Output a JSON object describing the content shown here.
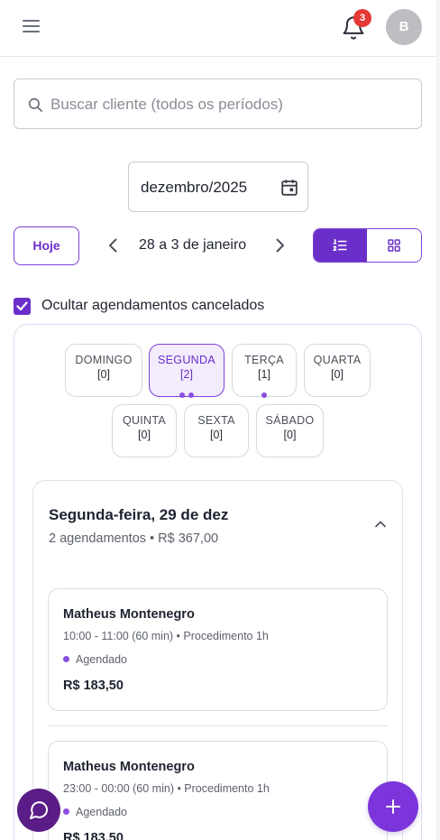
{
  "header": {
    "notifications_count": "3",
    "avatar_initial": "B"
  },
  "search": {
    "placeholder": "Buscar cliente (todos os períodos)"
  },
  "month_picker": {
    "value": "dezembro/2025"
  },
  "nav": {
    "today_label": "Hoje",
    "range_label": "28 a 3 de janeiro"
  },
  "filter": {
    "hide_cancelled_label": "Ocultar agendamentos cancelados",
    "hide_cancelled_checked": true
  },
  "week": {
    "days": [
      {
        "name": "DOMINGO",
        "count": "[0]"
      },
      {
        "name": "SEGUNDA",
        "count": "[2]"
      },
      {
        "name": "TERÇA",
        "count": "[1]"
      },
      {
        "name": "QUARTA",
        "count": "[0]"
      },
      {
        "name": "QUINTA",
        "count": "[0]"
      },
      {
        "name": "SEXTA",
        "count": "[0]"
      },
      {
        "name": "SÁBADO",
        "count": "[0]"
      }
    ],
    "selected_day": "SEGUNDA"
  },
  "day_detail": {
    "title": "Segunda-feira, 29 de dez",
    "summary": "2 agendamentos • R$ 367,00",
    "appointments": [
      {
        "client": "Matheus Montenegro",
        "time": "10:00 - 11:00 (60 min) • Procedimento 1h",
        "status": "Agendado",
        "price": "R$ 183,50"
      },
      {
        "client": "Matheus Montenegro",
        "time": "23:00 - 00:00 (60 min) • Procedimento 1h",
        "status": "Agendado",
        "price": "R$ 183,50"
      }
    ]
  },
  "colors": {
    "accent": "#6b2fc9",
    "badge": "#e53935",
    "chat_fab": "#5a1c86"
  },
  "icons": [
    "menu-icon",
    "bell-icon",
    "search-icon",
    "calendar-icon",
    "chevron-left-icon",
    "chevron-right-icon",
    "list-ordered-icon",
    "grid-icon",
    "check-icon",
    "chevron-up-icon",
    "chat-icon",
    "plus-icon"
  ]
}
